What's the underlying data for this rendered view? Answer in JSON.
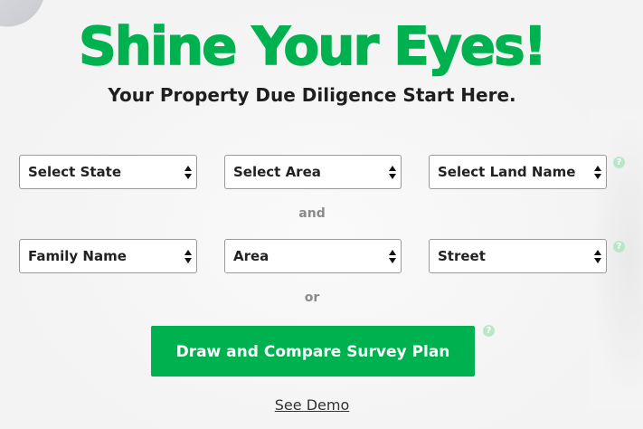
{
  "hero": {
    "title": "Shine Your Eyes!",
    "subtitle": "Your Property Due Diligence Start Here."
  },
  "row1": {
    "state": "Select State",
    "area": "Select Area",
    "land": "Select Land Name"
  },
  "separators": {
    "and": "and",
    "or": "or"
  },
  "row2": {
    "family": "Family Name",
    "area": "Area",
    "street": "Street"
  },
  "help_icon": "?",
  "actions": {
    "draw_compare": "Draw and Compare Survey Plan",
    "see_demo": "See Demo"
  },
  "colors": {
    "brand_green": "#00b14f",
    "help_green": "#b9e6c8"
  }
}
